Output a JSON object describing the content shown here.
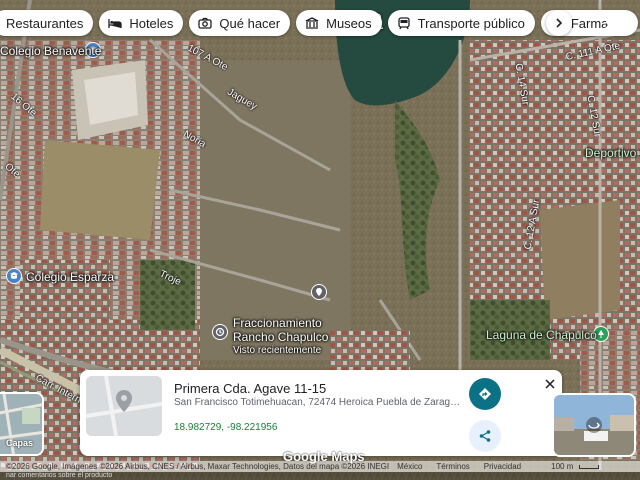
{
  "chips": [
    {
      "label": "Restaurantes",
      "icon": "restaurant-icon"
    },
    {
      "label": "Hoteles",
      "icon": "hotel-icon"
    },
    {
      "label": "Qué hacer",
      "icon": "camera-icon"
    },
    {
      "label": "Museos",
      "icon": "museum-icon"
    },
    {
      "label": "Transporte público",
      "icon": "transit-icon"
    },
    {
      "label": "Farma",
      "icon": "pharmacy-icon"
    }
  ],
  "map_labels": {
    "place_1": "Colegio Benavente",
    "place_2": "Colegio Esparza",
    "place_3_line1": "Fraccionamiento",
    "place_3_line2": "Rancho Chapulco",
    "place_3_sub": "Visto recientemente",
    "place_4": "Laguna de Chapulco",
    "place_5": "Deportivo S",
    "street_1": "107 A Ote",
    "street_2": "Jaguey",
    "street_3": "Noria",
    "street_4": "Troje",
    "street_5": "C. 111 A Ote",
    "street_6": "C. 12 Sur",
    "street_7": "C. 14 Sur",
    "street_8": "C. 12 A Sur",
    "street_9": "Carr. Intern",
    "street_10": "16 Ote",
    "street_11": "Ote",
    "street_12": "C. 1"
  },
  "layers_label": "Capas",
  "card": {
    "title": "Primera Cda. Agave 11-15",
    "address": "San Francisco Totimehuacan, 72474 Heroica Puebla de Zaragoza, Pue.",
    "coords": "18.982729, -98.221956"
  },
  "footer": {
    "logo": "Google Maps",
    "attribution": "©2026 Google, Imágenes ©2026 Airbus, CNES / Airbus, Maxar Technologies, Datos del mapa ©2026 INEGI",
    "country": "México",
    "terms": "Términos",
    "privacy": "Privacidad",
    "scale": "100 m",
    "bottom_note": "nar comentarios sobre el producto"
  },
  "colors": {
    "accent": "#0b7285",
    "coords": "#188038",
    "poi_school": "#4a83c5",
    "poi_park": "#2e9f5b"
  }
}
